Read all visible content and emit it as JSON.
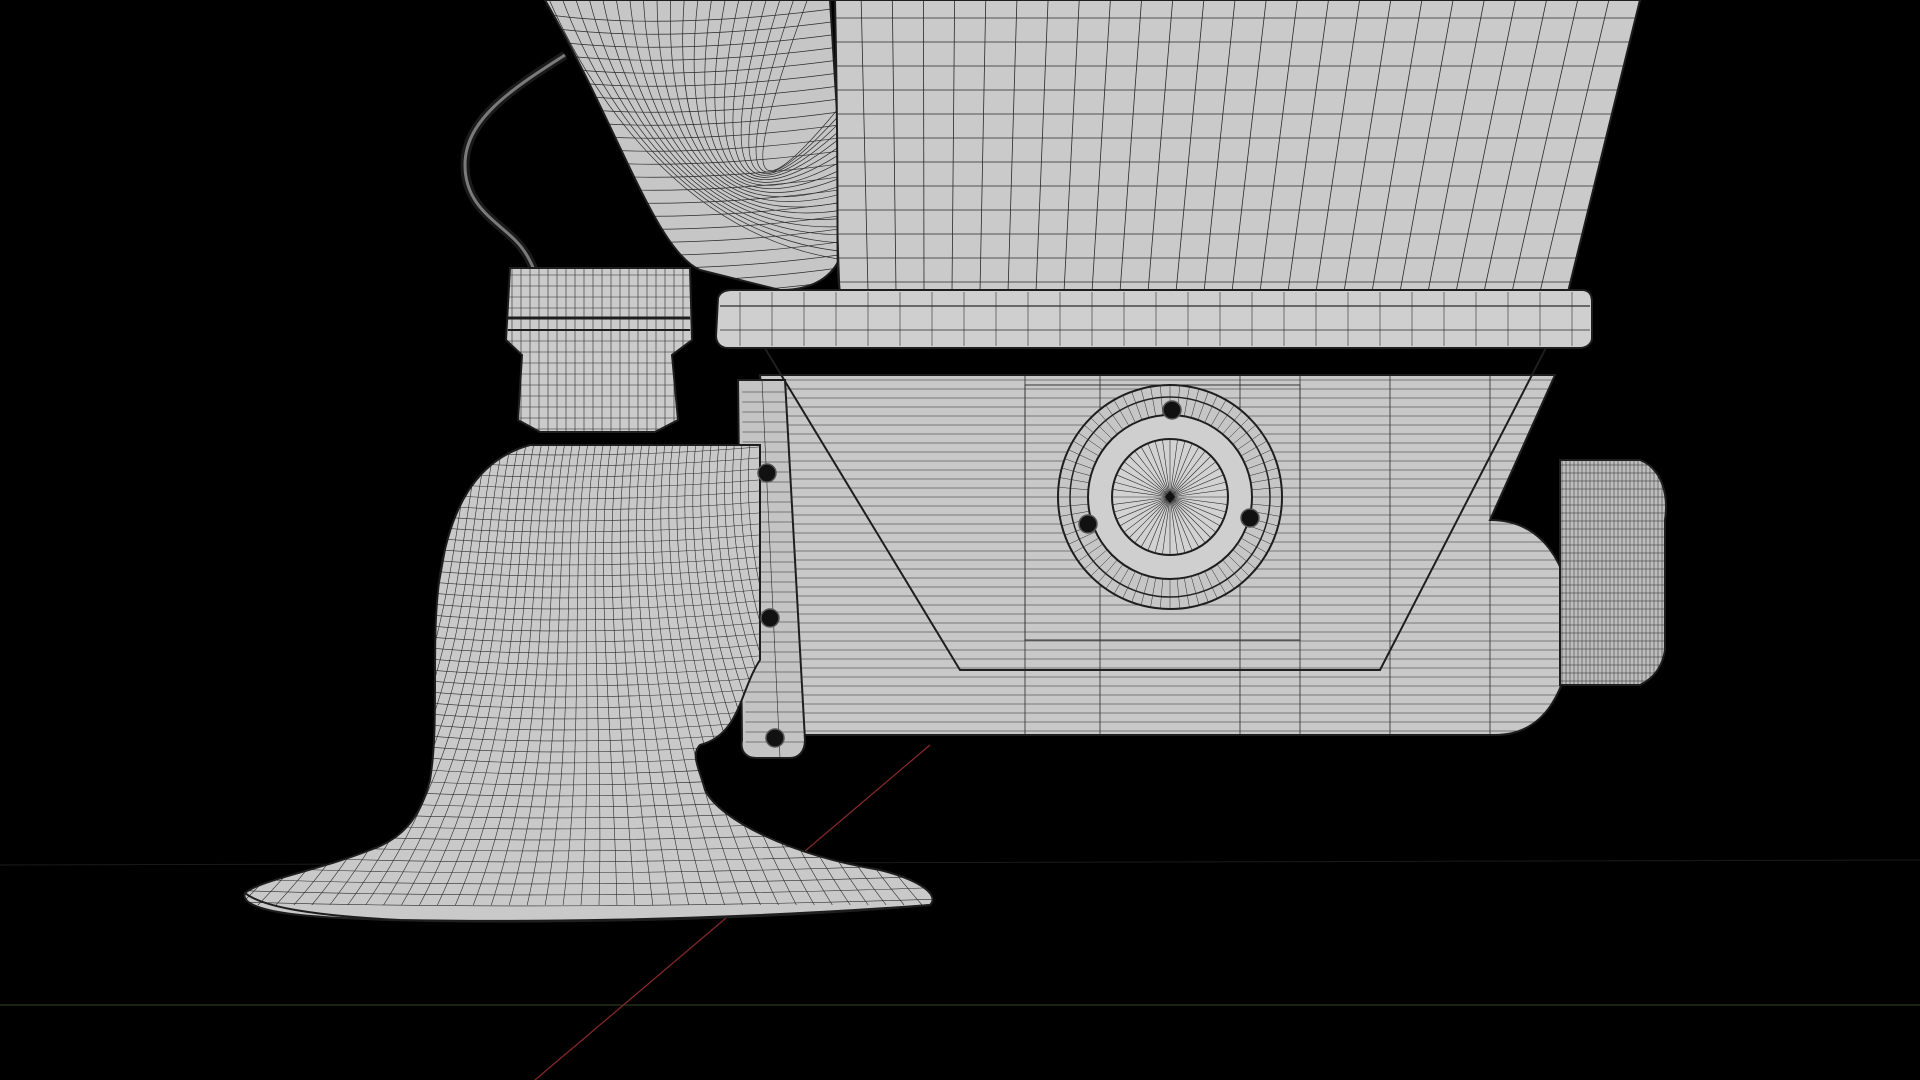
{
  "viewport": {
    "background": "#000000",
    "mesh_fill": "#c8c8c8",
    "mesh_fill_dark": "#9a9a9a",
    "wire_color": "#2a2a2a",
    "screw_color": "#111111",
    "axis_x_color": "#8a2a2a",
    "axis_y_color": "#3a5a2a",
    "horizon_color": "#2a2a2a"
  },
  "scene": {
    "subject": "wireframe-mesh",
    "parts": [
      "hopper",
      "top-flange",
      "grinder-body",
      "side-bracket",
      "front-knob",
      "collar-fitting",
      "cable",
      "elbow-spout",
      "flared-foot"
    ],
    "screw_count": 6
  }
}
